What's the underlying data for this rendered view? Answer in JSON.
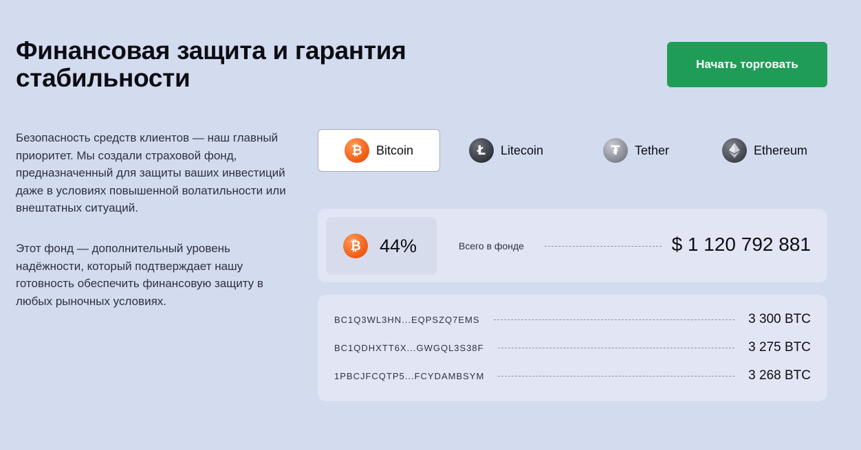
{
  "header": {
    "title": "Финансовая защита и гарантия стабильности",
    "cta_label": "Начать торговать"
  },
  "intro": {
    "paragraph1": "Безопасность средств клиентов — наш главный приоритет. Мы создали страховой фонд, предназначенный для защиты ваших инвестиций даже в условиях повышенной волатильности или внештатных ситуаций.",
    "paragraph2": "Этот фонд — дополнительный уровень надёжности, который подтверждает нашу готовность обеспечить финансовую защиту в любых рыночных условиях."
  },
  "tabs": [
    {
      "label": "Bitcoin",
      "icon": "bitcoin-icon",
      "active": true
    },
    {
      "label": "Litecoin",
      "icon": "litecoin-icon",
      "active": false
    },
    {
      "label": "Tether",
      "icon": "tether-icon",
      "active": false
    },
    {
      "label": "Ethereum",
      "icon": "ethereum-icon",
      "active": false
    }
  ],
  "fund": {
    "percent": "44%",
    "label": "Всего в фонде",
    "total": "$ 1 120 792 881"
  },
  "wallets": [
    {
      "address": "BC1Q3WL3HN...EQPSZQ7EMS",
      "amount": "3 300 BTC"
    },
    {
      "address": "BC1QDHXTT6X...GWGQL3S38F",
      "amount": "3 275 BTC"
    },
    {
      "address": "1PBCJFCQTP5...FCYDAMBSYM",
      "amount": "3 268 BTC"
    }
  ],
  "colors": {
    "background": "#d3dbef",
    "accent_green": "#1f9d57",
    "bitcoin_orange": "#f05a14",
    "card": "#e2e6f4"
  }
}
